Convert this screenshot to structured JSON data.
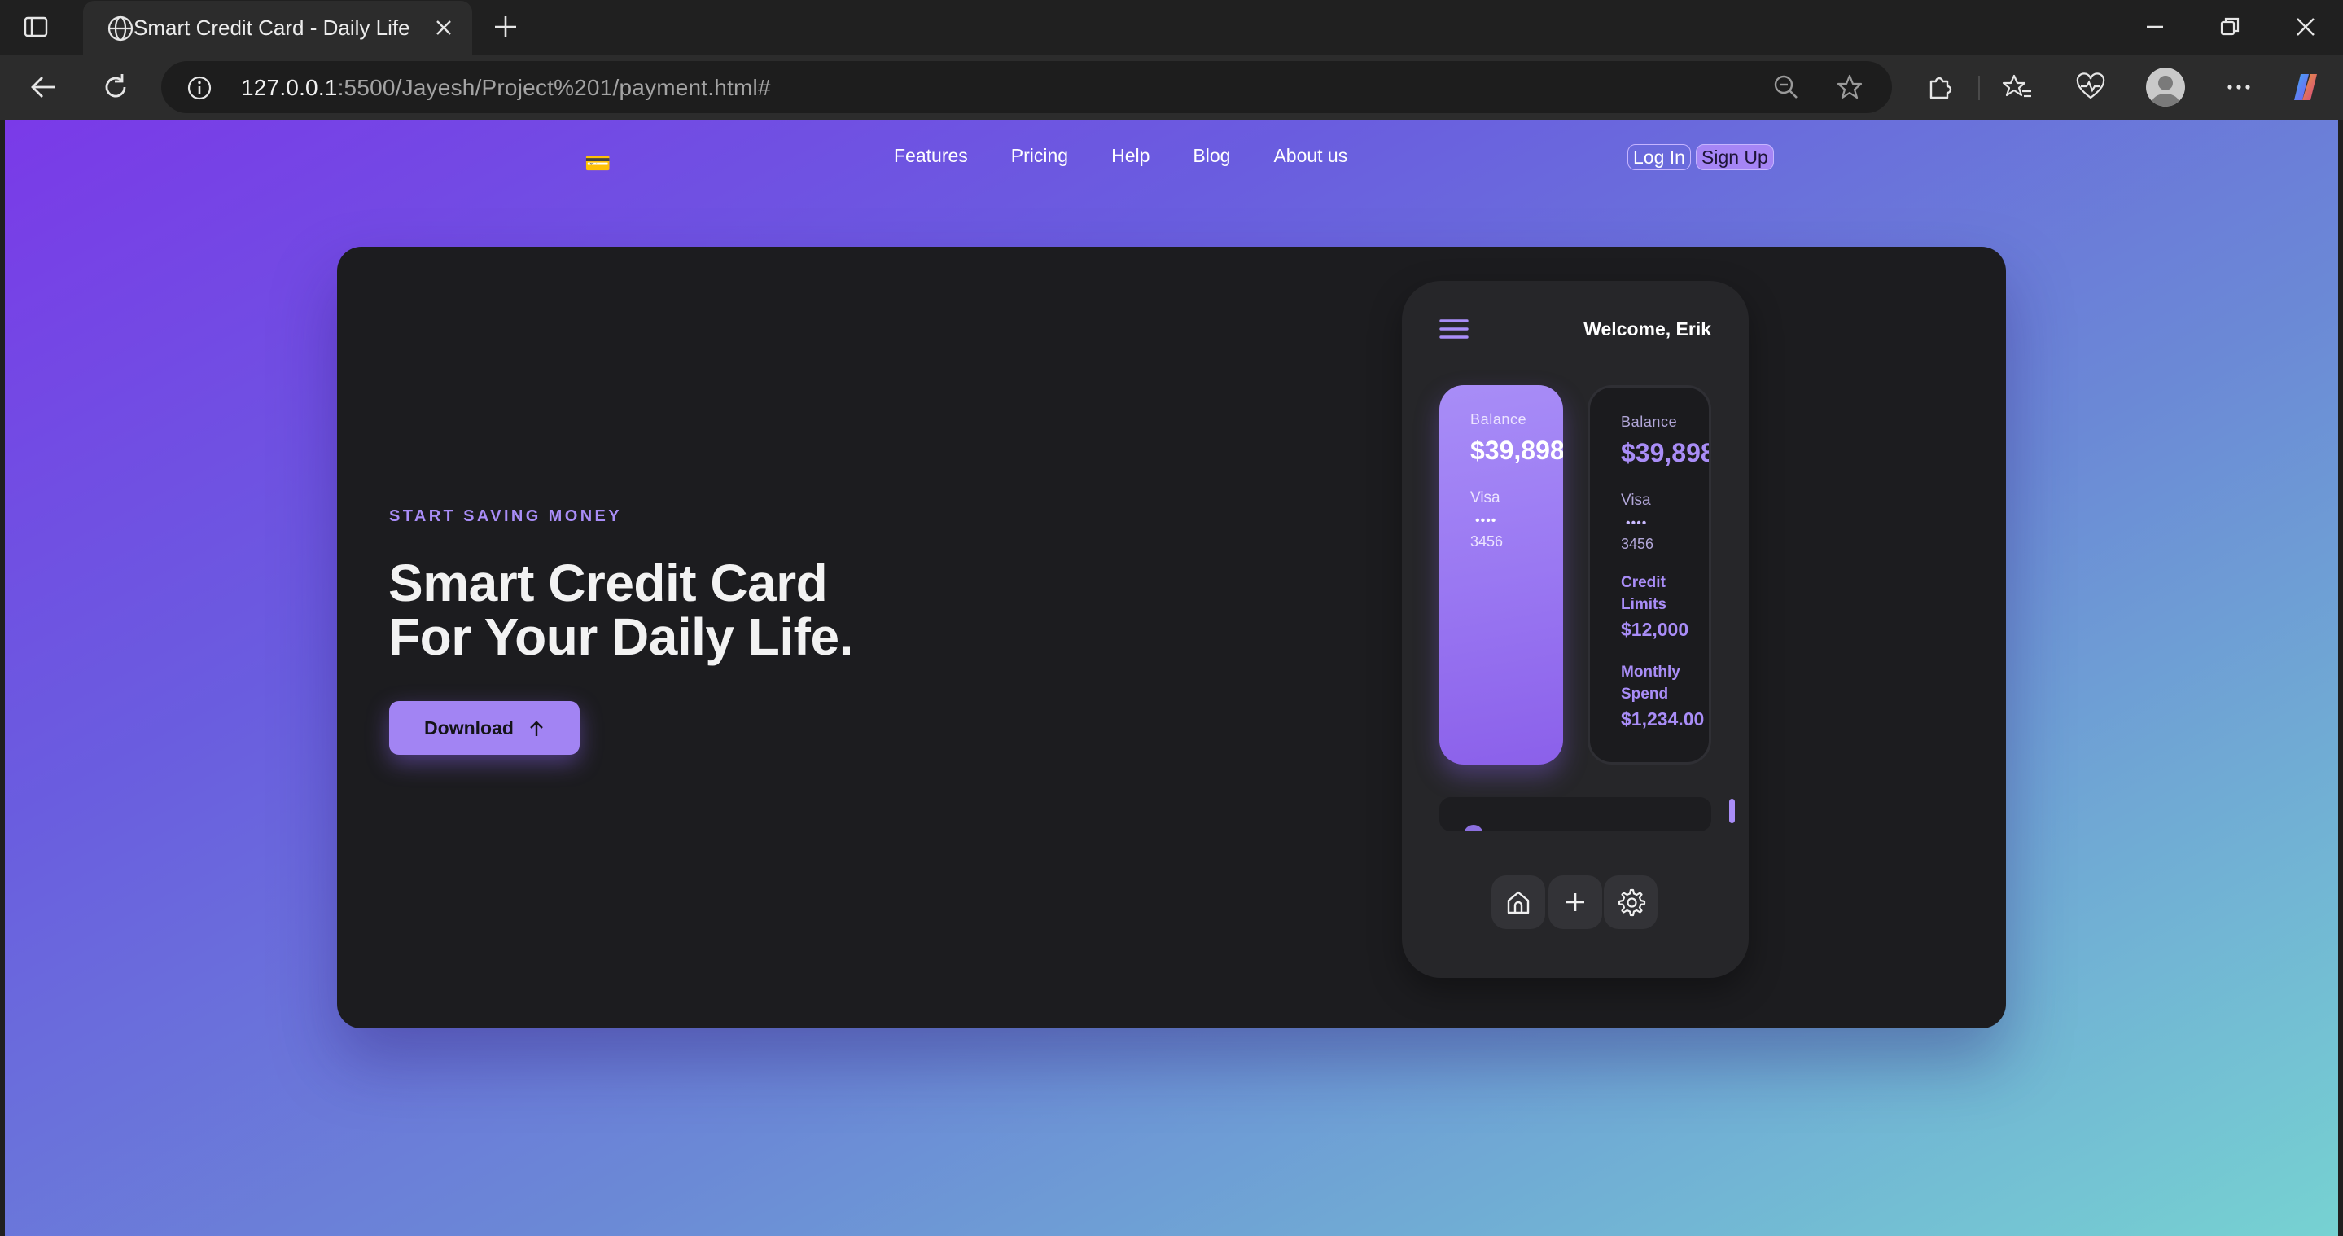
{
  "browser": {
    "tab_title": "Smart Credit Card - Daily Life",
    "url_host": "127.0.0.1",
    "url_rest": ":5500/Jayesh/Project%201/payment.html#"
  },
  "site": {
    "logo_glyph": "💳",
    "nav": {
      "items": [
        {
          "label": "Features"
        },
        {
          "label": "Pricing"
        },
        {
          "label": "Help"
        },
        {
          "label": "Blog"
        },
        {
          "label": "About us"
        }
      ],
      "login_label": "Log In",
      "signup_label": "Sign Up"
    },
    "hero": {
      "eyebrow": "START SAVING MONEY",
      "headline_line1": "Smart Credit Card",
      "headline_line2": "For Your Daily Life.",
      "download_label": "Download",
      "accent_color": "#a284f3"
    },
    "phone": {
      "welcome": "Welcome, Erik",
      "cards": [
        {
          "label": "Balance",
          "balance": "$39,898",
          "brand": "Visa",
          "dots": "••••",
          "last4": "3456"
        },
        {
          "label": "Balance",
          "balance": "$39,898",
          "brand": "Visa",
          "dots": "••••",
          "last4": "3456",
          "credit_label": "Credit Limits",
          "credit_value": "$12,000",
          "spend_label": "Monthly Spend",
          "spend_value": "$1,234.00"
        }
      ],
      "buttons": [
        "home-icon",
        "plus-icon",
        "gear-icon"
      ]
    }
  }
}
